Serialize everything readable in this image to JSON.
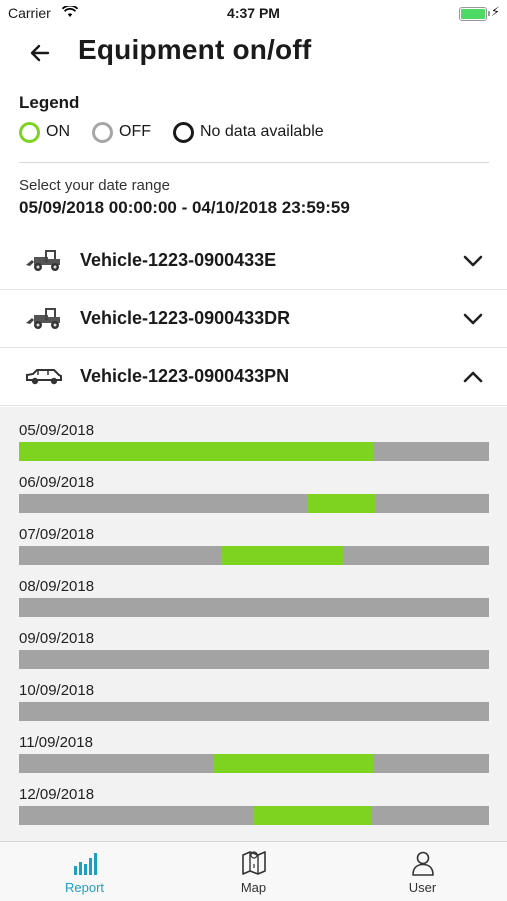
{
  "status_bar": {
    "carrier": "Carrier",
    "time": "4:37 PM"
  },
  "header": {
    "title": "Equipment on/off"
  },
  "legend": {
    "title": "Legend",
    "items": [
      {
        "label": "ON",
        "color": "#7ed321"
      },
      {
        "label": "OFF",
        "color": "#a6a6a6"
      },
      {
        "label": "No data available",
        "color": "#1a1a1a"
      }
    ]
  },
  "date_range": {
    "label": "Select your date range",
    "value": "05/09/2018 00:00:00 - 04/10/2018 23:59:59"
  },
  "vehicles": [
    {
      "name": "Vehicle-1223-0900433E",
      "icon": "loader-icon",
      "expanded": false
    },
    {
      "name": "Vehicle-1223-0900433DR",
      "icon": "loader-icon",
      "expanded": false
    },
    {
      "name": "Vehicle-1223-0900433PN",
      "icon": "car-icon",
      "expanded": true
    }
  ],
  "timeline": {
    "colors": {
      "on": "#7ed321",
      "off": "#a3a3a3"
    },
    "days": [
      {
        "date": "05/09/2018",
        "on_fraction": [
          [
            0.0,
            0.755
          ]
        ]
      },
      {
        "date": "06/09/2018",
        "on_fraction": [
          [
            0.615,
            0.76
          ]
        ]
      },
      {
        "date": "07/09/2018",
        "on_fraction": [
          [
            0.43,
            0.69
          ]
        ]
      },
      {
        "date": "08/09/2018",
        "on_fraction": []
      },
      {
        "date": "09/09/2018",
        "on_fraction": []
      },
      {
        "date": "10/09/2018",
        "on_fraction": []
      },
      {
        "date": "11/09/2018",
        "on_fraction": [
          [
            0.415,
            0.755
          ]
        ]
      },
      {
        "date": "12/09/2018",
        "on_fraction": [
          [
            0.5,
            0.75
          ]
        ]
      }
    ]
  },
  "tabs": [
    {
      "label": "Report",
      "icon": "report-icon",
      "active": true
    },
    {
      "label": "Map",
      "icon": "map-icon",
      "active": false
    },
    {
      "label": "User",
      "icon": "user-icon",
      "active": false
    }
  ]
}
